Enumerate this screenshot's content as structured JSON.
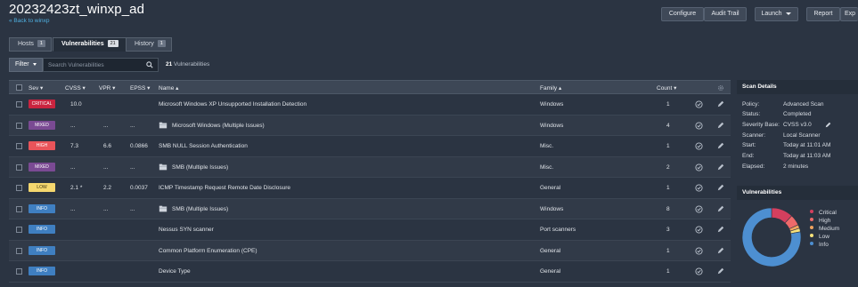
{
  "header": {
    "title": "20232423zt_winxp_ad",
    "back_link": "« Back to winxp"
  },
  "toolbar": {
    "configure": "Configure",
    "audit_trail": "Audit Trail",
    "launch": "Launch",
    "report": "Report",
    "export": "Exp"
  },
  "tabs": [
    {
      "label": "Hosts",
      "count": "1"
    },
    {
      "label": "Vulnerabilities",
      "count": "21"
    },
    {
      "label": "History",
      "count": "1"
    }
  ],
  "filterbar": {
    "filter_label": "Filter",
    "search_placeholder": "Search Vulnerabilities",
    "count_number": "21",
    "count_text": "Vulnerabilities"
  },
  "table": {
    "columns": {
      "sev": "Sev ▾",
      "cvss": "CVSS ▾",
      "vpr": "VPR ▾",
      "epss": "EPSS ▾",
      "name": "Name ▴",
      "family": "Family ▴",
      "count": "Count ▾"
    },
    "rows": [
      {
        "sev": "CRITICAL",
        "cvss": "10.0",
        "vpr": "",
        "epss": "",
        "name": "Microsoft Windows XP Unsupported Installation Detection",
        "family": "Windows",
        "count": "1",
        "group": false
      },
      {
        "sev": "MIXED",
        "cvss": "...",
        "vpr": "...",
        "epss": "...",
        "name": "Microsoft Windows (Multiple Issues)",
        "family": "Windows",
        "count": "4",
        "group": true
      },
      {
        "sev": "HIGH",
        "cvss": "7.3",
        "vpr": "6.6",
        "epss": "0.0866",
        "name": "SMB NULL Session Authentication",
        "family": "Misc.",
        "count": "1",
        "group": false
      },
      {
        "sev": "MIXED",
        "cvss": "...",
        "vpr": "...",
        "epss": "...",
        "name": "SMB (Multiple Issues)",
        "family": "Misc.",
        "count": "2",
        "group": true
      },
      {
        "sev": "LOW",
        "cvss": "2.1 *",
        "vpr": "2.2",
        "epss": "0.0037",
        "name": "ICMP Timestamp Request Remote Date Disclosure",
        "family": "General",
        "count": "1",
        "group": false
      },
      {
        "sev": "INFO",
        "cvss": "...",
        "vpr": "...",
        "epss": "...",
        "name": "SMB (Multiple Issues)",
        "family": "Windows",
        "count": "8",
        "group": true
      },
      {
        "sev": "INFO",
        "cvss": "",
        "vpr": "",
        "epss": "",
        "name": "Nessus SYN scanner",
        "family": "Port scanners",
        "count": "3",
        "group": false
      },
      {
        "sev": "INFO",
        "cvss": "",
        "vpr": "",
        "epss": "",
        "name": "Common Platform Enumeration (CPE)",
        "family": "General",
        "count": "1",
        "group": false
      },
      {
        "sev": "INFO",
        "cvss": "",
        "vpr": "",
        "epss": "",
        "name": "Device Type",
        "family": "General",
        "count": "1",
        "group": false
      }
    ]
  },
  "scan_details": {
    "title": "Scan Details",
    "policy_label": "Policy:",
    "policy": "Advanced Scan",
    "status_label": "Status:",
    "status": "Completed",
    "severity_label": "Severity Base:",
    "severity": "CVSS v3.0",
    "scanner_label": "Scanner:",
    "scanner": "Local Scanner",
    "start_label": "Start:",
    "start": "Today at 11:01 AM",
    "end_label": "End:",
    "end": "Today at 11:03 AM",
    "elapsed_label": "Elapsed:",
    "elapsed": "2 minutes"
  },
  "vulnerabilities_panel": {
    "title": "Vulnerabilities",
    "legend": [
      {
        "label": "Critical",
        "color": "#d43f5e"
      },
      {
        "label": "High",
        "color": "#ee6a6a"
      },
      {
        "label": "Medium",
        "color": "#f0a35e"
      },
      {
        "label": "Low",
        "color": "#f7e27b"
      },
      {
        "label": "Info",
        "color": "#4d8fd1"
      }
    ],
    "donut_fractions": [
      0.12,
      0.06,
      0.02,
      0.02,
      0.78
    ]
  },
  "colors": {
    "CRITICAL": "#c9243f",
    "HIGH": "#e9545a",
    "MIXED": "#7a4a93",
    "LOW": "#f5d76e",
    "INFO": "#3f7fc1"
  }
}
